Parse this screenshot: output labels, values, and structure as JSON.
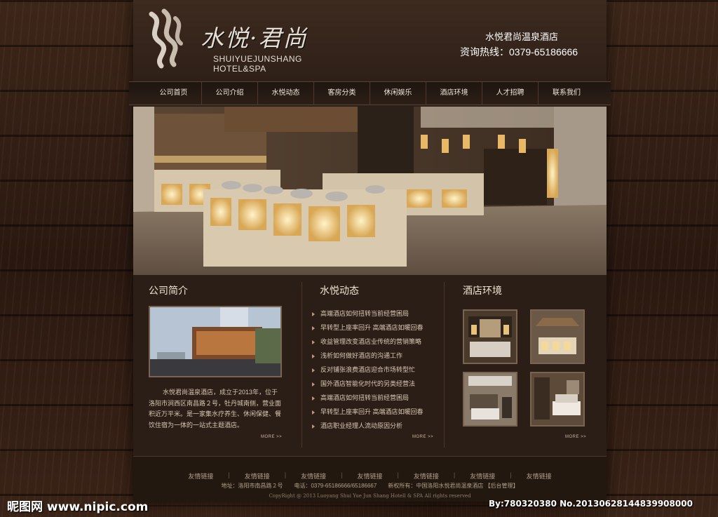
{
  "header": {
    "logo_cn": "水悦·君尚",
    "logo_en_line1": "SHUIYUEJUNSHANG",
    "logo_en_line2": "HOTEL&SPA",
    "hotel_name": "水悦君尚温泉酒店",
    "hotline": "资询热线：0379-65186666"
  },
  "nav": {
    "items": [
      "公司首页",
      "公司介绍",
      "水悦动态",
      "客房分类",
      "休闲娱乐",
      "酒店环境",
      "人才招聘",
      "联系我们"
    ]
  },
  "intro": {
    "title": "公司简介",
    "text": "水悦君尚温泉酒店，成立于2013年，位于洛阳市涧西区南昌路２号，牡丹城南侧，营业面积近万平米。是一家集水疗养生、休闲保健、餐饮住宿为一体的一站式主题酒店。",
    "more": "MORE >>"
  },
  "news": {
    "title": "水悦动态",
    "items": [
      "高端酒店如何扭转当前经营困局",
      "早转型上座率回升 高端酒店如暖回春",
      "收益管理改变酒店业传统的营销策略",
      "浅析如何做好酒店的沟通工作",
      "反对铺张浪费酒店迎合市场转型忙",
      "国外酒店智能化时代的另类经营法",
      "高端酒店如何扭转当前经营困局",
      "早转型上座率回升 高端酒店如暖回春",
      "酒店职业经理人流动原因分析"
    ],
    "more": "MORE >>"
  },
  "environment": {
    "title": "酒店环境",
    "more": "MORE >>"
  },
  "footer": {
    "links": [
      "友情链接",
      "友情链接",
      "友情链接",
      "友情链接",
      "友情链接",
      "友情链接",
      "友情链接"
    ],
    "address": "地址：洛阳市南昌路２号　　电话：0379-65186666/65186667　　新权所有：中国洛阳水悦君尚温泉酒店 【后台管理】",
    "copyright": "CopyRight @ 2013 Luoyang Shui Yue Jun Shang Hotell & SPA All rights reserved"
  },
  "watermark": {
    "left": "昵图网 www.nipic.com",
    "right": "By:780320380 No.20130628144839908000"
  },
  "colors": {
    "page_bg": "#2b1e16",
    "wood": "#3a2417",
    "text": "#d6c7b4",
    "bullet": "#b89c7d"
  }
}
